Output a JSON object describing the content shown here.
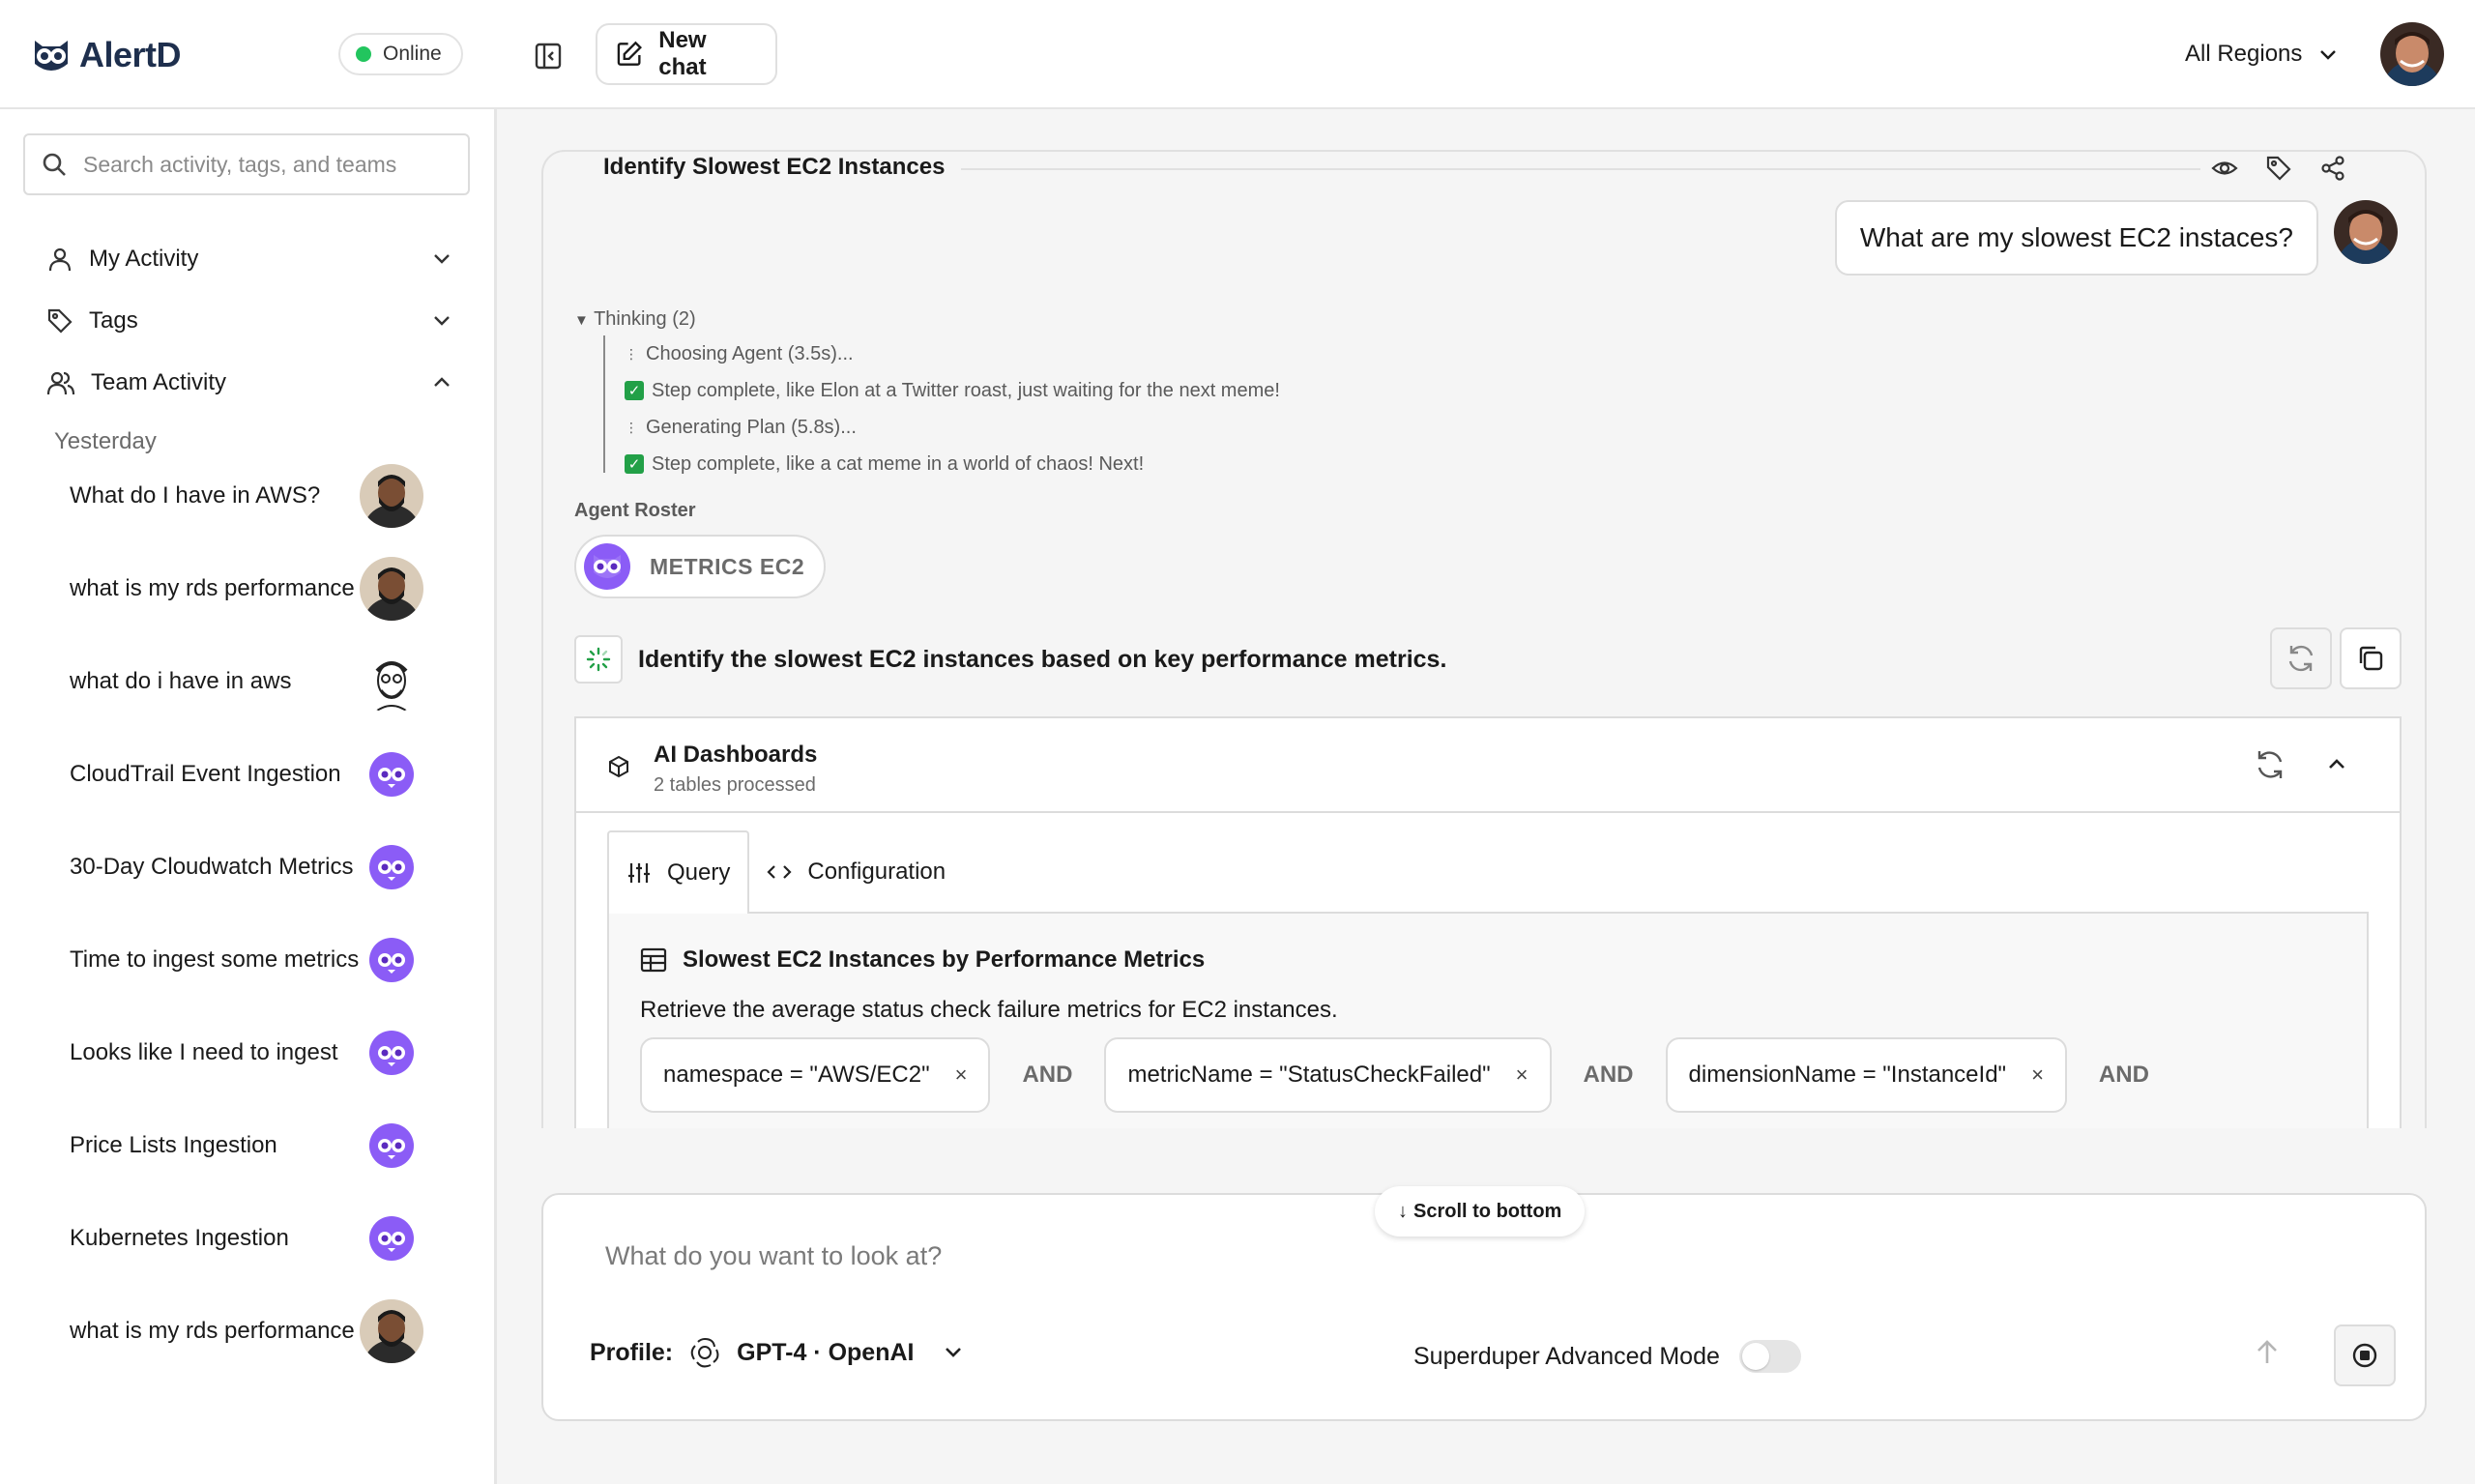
{
  "app": {
    "name": "AlertD",
    "status": "Online",
    "new_chat_label": "New chat",
    "region_selector": "All Regions"
  },
  "sidebar": {
    "search_placeholder": "Search activity, tags, and teams",
    "nav": [
      {
        "label": "My Activity",
        "icon": "user-icon",
        "state": "collapsed"
      },
      {
        "label": "Tags",
        "icon": "tag-icon",
        "state": "collapsed"
      },
      {
        "label": "Team Activity",
        "icon": "users-icon",
        "state": "expanded"
      }
    ],
    "section_label": "Yesterday",
    "items": [
      {
        "label": "What do I have in AWS?",
        "avatar": "user-photo"
      },
      {
        "label": "what is my rds performance",
        "avatar": "user-photo"
      },
      {
        "label": "what do i have in aws",
        "avatar": "sketch-avatar"
      },
      {
        "label": "CloudTrail Event Ingestion",
        "avatar": "owl-icon"
      },
      {
        "label": "30-Day Cloudwatch Metrics",
        "avatar": "owl-icon"
      },
      {
        "label": "Time to ingest some metrics",
        "avatar": "owl-icon"
      },
      {
        "label": "Looks like I need to ingest",
        "avatar": "owl-icon"
      },
      {
        "label": "Price Lists Ingestion",
        "avatar": "owl-icon"
      },
      {
        "label": "Kubernetes Ingestion",
        "avatar": "owl-icon"
      },
      {
        "label": "what is my rds performance",
        "avatar": "user-photo"
      }
    ]
  },
  "chat": {
    "title": "Identify Slowest EC2 Instances",
    "user_message": "What are my slowest EC2 instaces?",
    "thinking_label": "Thinking (2)",
    "thinking_steps": [
      {
        "icon": "dots-icon",
        "text": "Choosing Agent (3.5s)..."
      },
      {
        "icon": "check-icon",
        "text": "Step complete, like Elon at a Twitter roast, just waiting for the next meme!"
      },
      {
        "icon": "dots-icon",
        "text": "Generating Plan (5.8s)..."
      },
      {
        "icon": "check-icon",
        "text": "Step complete, like a cat meme in a world of chaos! Next!"
      }
    ],
    "agent_roster_label": "Agent Roster",
    "agent_name": "METRICS EC2",
    "task_text": "Identify the slowest EC2 instances based on key performance metrics.",
    "dashboard": {
      "title": "AI Dashboards",
      "subtitle": "2 tables processed",
      "tabs": [
        "Query",
        "Configuration"
      ],
      "active_tab": "Query",
      "table_title": "Slowest EC2 Instances by Performance Metrics",
      "description": "Retrieve the average status check failure metrics for EC2 instances.",
      "filters": [
        "namespace = \"AWS/EC2\"",
        "metricName = \"StatusCheckFailed\"",
        "dimensionName = \"InstanceId\""
      ],
      "and_label": "AND",
      "remove_glyph": "×"
    }
  },
  "composer": {
    "scroll_label": "Scroll to bottom",
    "placeholder": "What do you want to look at?",
    "profile_label": "Profile:",
    "profile_value": "GPT-4 · OpenAI",
    "advanced_mode_label": "Superduper Advanced Mode",
    "advanced_mode_on": false
  },
  "colors": {
    "brand": "#1e2f4d",
    "online": "#22c55e",
    "owl": "#8b5cf6",
    "check": "#22a047"
  }
}
